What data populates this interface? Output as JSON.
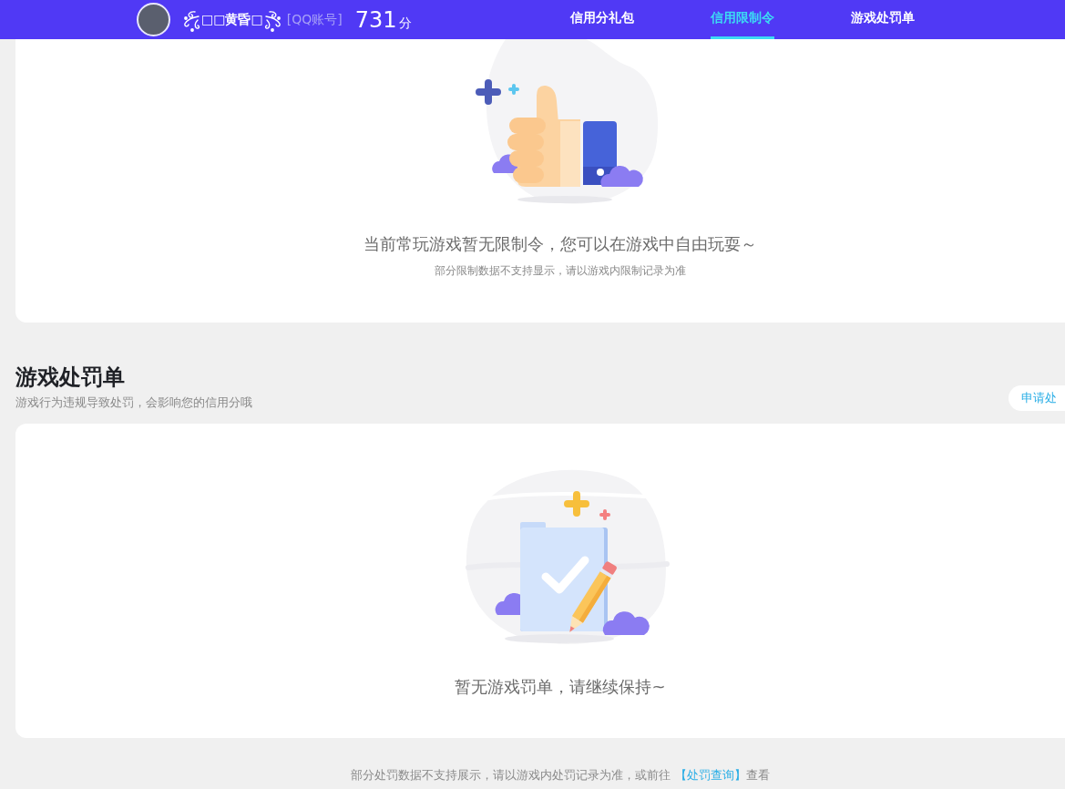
{
  "header": {
    "nickname": "□□黄昏□",
    "account_label": "[QQ账号]",
    "score": "731",
    "score_unit": "分"
  },
  "nav": {
    "tabs": [
      {
        "label": "信用分礼包",
        "selected": false
      },
      {
        "label": "信用限制令",
        "selected": true
      },
      {
        "label": "游戏处罚单",
        "selected": false
      }
    ]
  },
  "restriction_card": {
    "message": "当前常玩游戏暂无限制令，您可以在游戏中自由玩耍～",
    "note": "部分限制数据不支持显示，请以游戏内限制记录为准"
  },
  "penalty_section": {
    "title": "游戏处罚单",
    "subtitle": "游戏行为违规导致处罚，会影响您的信用分哦",
    "apply_button": "申请处",
    "message": "暂无游戏罚单，请继续保持~"
  },
  "footer": {
    "text_before": "部分处罚数据不支持展示，请以游戏内处罚记录为准，或前往 ",
    "link": "【处罚查询】",
    "text_after": "查看"
  }
}
